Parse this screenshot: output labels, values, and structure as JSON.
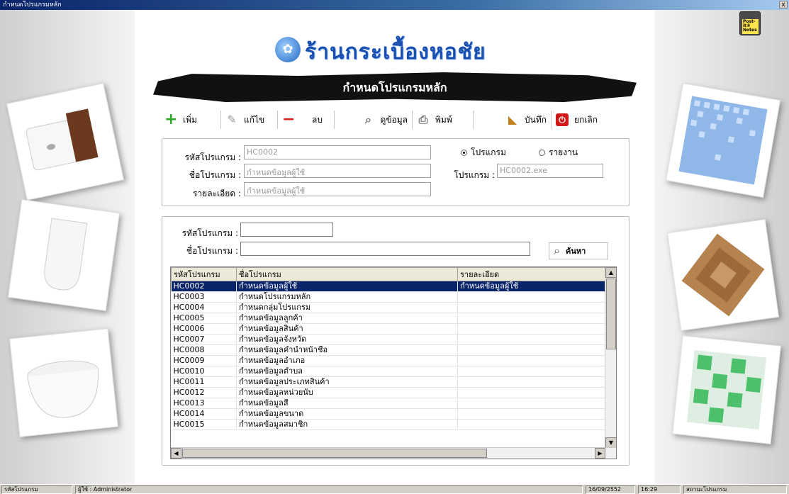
{
  "window": {
    "title": "กำหนดโปรแกรมหลัก",
    "close_label": "x"
  },
  "logo": {
    "text": "ร้านกระเบื้องหอชัย"
  },
  "banner": {
    "title": "กำหนดโปรแกรมหลัก"
  },
  "postit": {
    "label": "Post-it® Notes"
  },
  "toolbar": {
    "add": "เพิ่ม",
    "edit": "แก้ไข",
    "delete": "ลบ",
    "view": "ดูข้อมูล",
    "print": "พิมพ์",
    "save": "บันทึก",
    "cancel": "ยกเลิก"
  },
  "form": {
    "program_code_label": "รหัสโปรแกรม :",
    "program_code_value": "HC0002",
    "program_name_label": "ชื่อโปรแกรม :",
    "program_name_value": "กำหนดข้อมูลผู้ใช้",
    "detail_label": "รายละเอียด :",
    "detail_value": "กำหนดข้อมูลผู้ใช้",
    "radio_program": "โปรแกรม",
    "radio_report": "รายงาน",
    "program_file_label": "โปรแกรม :",
    "program_file_value": "HC0002.exe"
  },
  "search": {
    "code_label": "รหัสโปรแกรม :",
    "code_value": "",
    "name_label": "ชื่อโปรแกรม :",
    "name_value": "",
    "button": "ค้นหา"
  },
  "grid": {
    "columns": [
      "รหัสโปรแกรม",
      "ชื่อโปรแกรม",
      "รายละเอียด"
    ],
    "rows": [
      [
        "HC0002",
        "กำหนดข้อมูลผู้ใช้",
        "กำหนดข้อมูลผู้ใช้"
      ],
      [
        "HC0003",
        "กำหนดโปรแกรมหลัก",
        ""
      ],
      [
        "HC0004",
        "กำหนดกลุ่มโปรแกรม",
        ""
      ],
      [
        "HC0005",
        "กำหนดข้อมูลลูกค้า",
        ""
      ],
      [
        "HC0006",
        "กำหนดข้อมูลสินค้า",
        ""
      ],
      [
        "HC0007",
        "กำหนดข้อมูลจังหวัด",
        ""
      ],
      [
        "HC0008",
        "กำหนดข้อมูลคำนำหน้าชื่อ",
        ""
      ],
      [
        "HC0009",
        "กำหนดข้อมูลอำเภอ",
        ""
      ],
      [
        "HC0010",
        "กำหนดข้อมูลตำบล",
        ""
      ],
      [
        "HC0011",
        "กำหนดข้อมูลประเภทสินค้า",
        ""
      ],
      [
        "HC0012",
        "กำหนดข้อมูลหน่วยนับ",
        ""
      ],
      [
        "HC0013",
        "กำหนดข้อมูลสี",
        ""
      ],
      [
        "HC0014",
        "กำหนดข้อมูลขนาด",
        ""
      ],
      [
        "HC0015",
        "กำหนดข้อมูลสมาชิก",
        ""
      ]
    ],
    "selected_row": 0
  },
  "status": {
    "field": "รหัสโปรแกรม",
    "user": "ผู้ใช้ : Administrator",
    "date": "16/09/2552",
    "time": "16:29",
    "state": "สถานะโปรแกรม"
  },
  "colors": {
    "selection": "#0a246a",
    "brand": "#1a4fb0",
    "titlebar": "#0a246a"
  }
}
